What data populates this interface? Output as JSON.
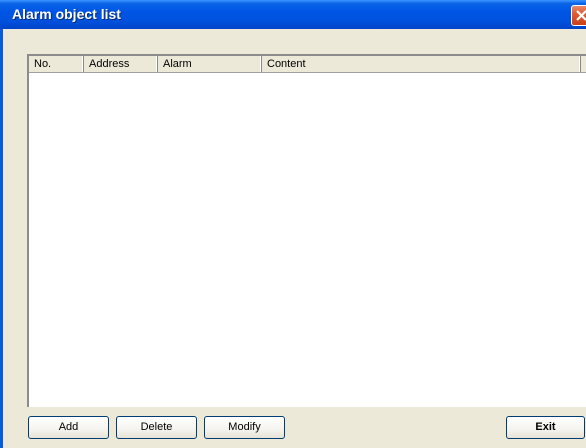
{
  "window": {
    "title": "Alarm object list"
  },
  "listview": {
    "columns": [
      "No.",
      "Address",
      "Alarm",
      "Content"
    ],
    "rows": []
  },
  "buttons": {
    "add": "Add",
    "delete": "Delete",
    "modify": "Modify",
    "exit": "Exit"
  },
  "colors": {
    "titlebar": "#0055e5",
    "window_bg": "#ece9d8",
    "close_button": "#e05a32"
  },
  "icons": {
    "close": "close-icon"
  }
}
